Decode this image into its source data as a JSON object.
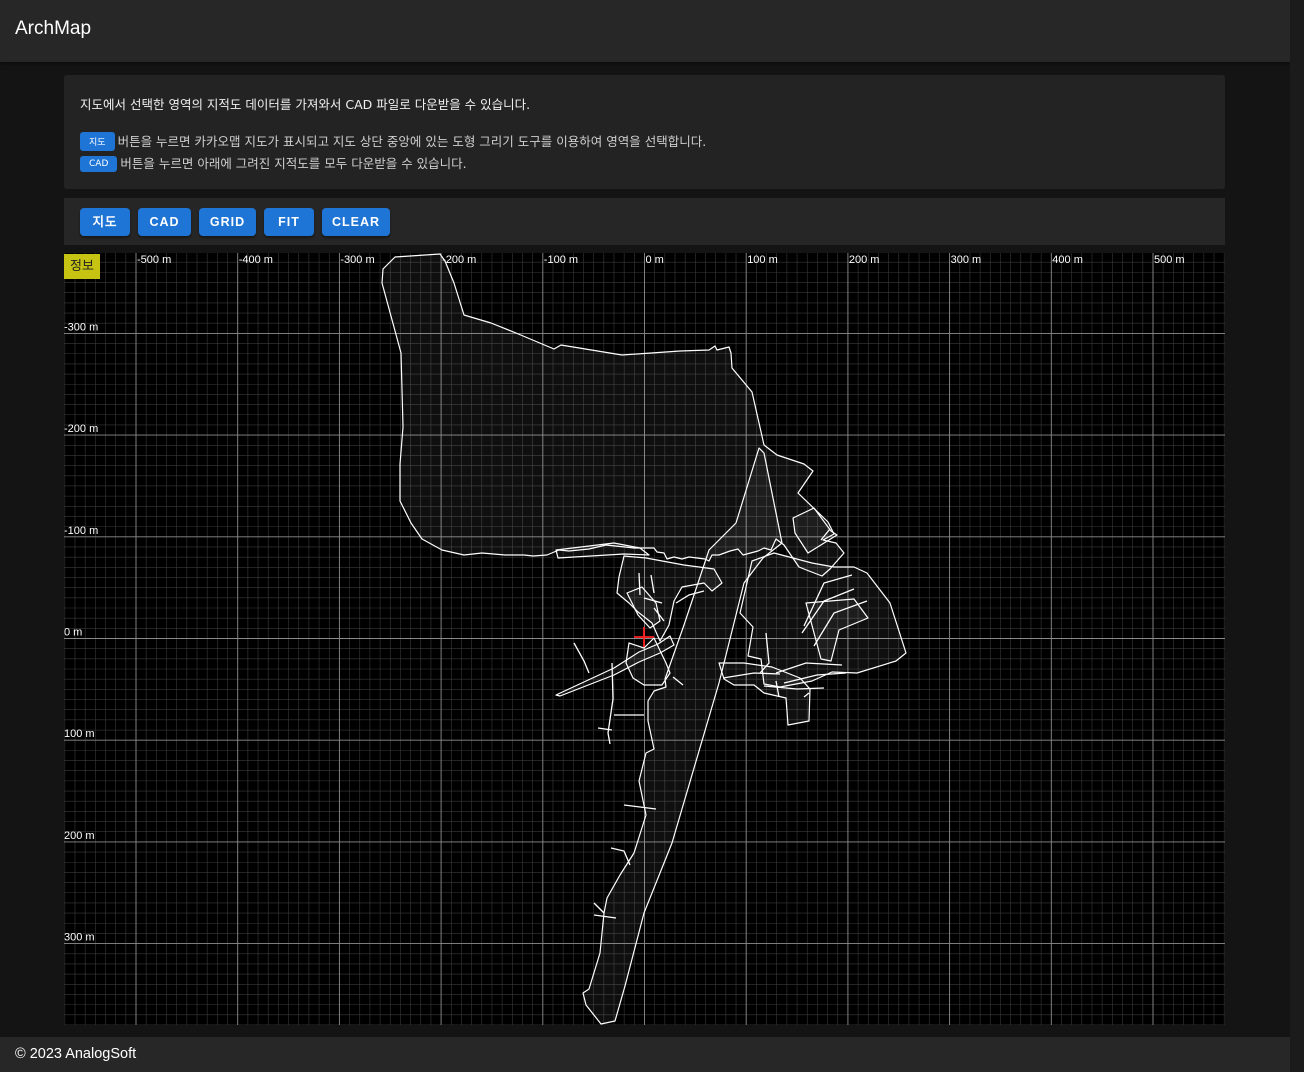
{
  "app": {
    "title": "ArchMap"
  },
  "info": {
    "intro": "지도에서 선택한 영역의 지적도 데이터를 가져와서 CAD 파일로 다운받을 수 있습니다.",
    "map_chip": "지도",
    "map_text": "버튼을 누르면 카카오맵 지도가 표시되고 지도 상단 중앙에 있는 도형 그리기 도구를 이용하여 영역을 선택합니다.",
    "cad_chip": "CAD",
    "cad_text": "버튼을 누르면 아래에 그려진 지적도를 모두 다운받을 수 있습니다."
  },
  "toolbar": {
    "map_label": "지도",
    "cad_label": "CAD",
    "grid_label": "GRID",
    "fit_label": "FIT",
    "clear_label": "CLEAR"
  },
  "viewer": {
    "info_badge": "정보",
    "x_ticks": [
      "-500 m",
      "-400 m",
      "-300 m",
      "-200 m",
      "-100 m",
      "0 m",
      "100 m",
      "200 m",
      "300 m",
      "400 m",
      "500 m"
    ],
    "y_ticks": [
      "-300 m",
      "-200 m",
      "-100 m",
      "0 m",
      "100 m",
      "200 m",
      "300 m"
    ],
    "colors": {
      "background": "#000000",
      "grid_major": "#8a8a8a",
      "grid_minor": "#3a3a3a",
      "parcel": "#ffffff",
      "origin_marker": "#ff2020"
    }
  },
  "footer": {
    "copyright": "© 2023 AnalogSoft"
  }
}
